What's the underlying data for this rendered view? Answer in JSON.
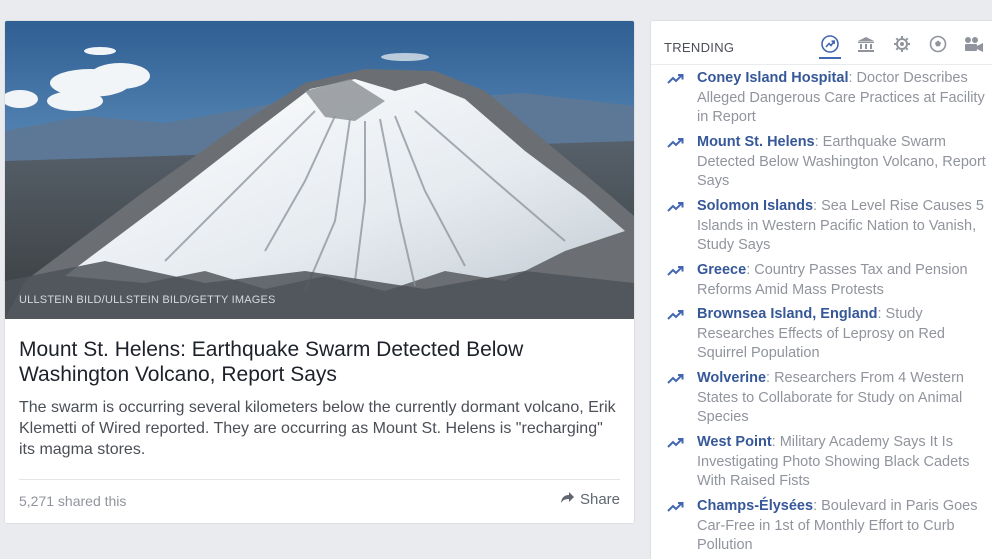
{
  "story": {
    "photo_alt": "Aerial view of a snow-covered volcano",
    "photo_credit": "ULLSTEIN BILD/ULLSTEIN BILD/GETTY IMAGES",
    "headline_topic": "Mount St. Helens",
    "headline_rest": ": Earthquake Swarm Detected Below Washington Volcano, Report Says",
    "blurb": "The swarm is occurring several kilometers below the currently dormant volcano, Erik Klemetti of Wired reported. They are occurring as Mount St. Helens is \"recharging\" its magma stores.",
    "shared_count": "5,271 shared this",
    "share_label": "Share"
  },
  "trending": {
    "title": "TRENDING",
    "tabs": [
      {
        "icon": "trending-icon",
        "active": true
      },
      {
        "icon": "politics-icon",
        "active": false
      },
      {
        "icon": "science-icon",
        "active": false
      },
      {
        "icon": "sports-icon",
        "active": false
      },
      {
        "icon": "entertainment-icon",
        "active": false
      }
    ],
    "accent_color": "#4267b2",
    "items": [
      {
        "topic": "Coney Island Hospital",
        "text": ": Doctor Describes Alleged Dangerous Care Practices at Facility in Report"
      },
      {
        "topic": "Mount St. Helens",
        "text": ": Earthquake Swarm Detected Below Washington Volcano, Report Says"
      },
      {
        "topic": "Solomon Islands",
        "text": ": Sea Level Rise Causes 5 Islands in Western Pacific Nation to Vanish, Study Says"
      },
      {
        "topic": "Greece",
        "text": ": Country Passes Tax and Pension Reforms Amid Mass Protests"
      },
      {
        "topic": "Brownsea Island, England",
        "text": ": Study Researches Effects of Leprosy on Red Squirrel Population"
      },
      {
        "topic": "Wolverine",
        "text": ": Researchers From 4 Western States to Collaborate for Study on Animal Species"
      },
      {
        "topic": "West Point",
        "text": ": Military Academy Says It Is Investigating Photo Showing Black Cadets With Raised Fists"
      },
      {
        "topic": "Champs-Élysées",
        "text": ": Boulevard in Paris Goes Car-Free in 1st of Monthly Effort to Curb Pollution"
      }
    ]
  }
}
